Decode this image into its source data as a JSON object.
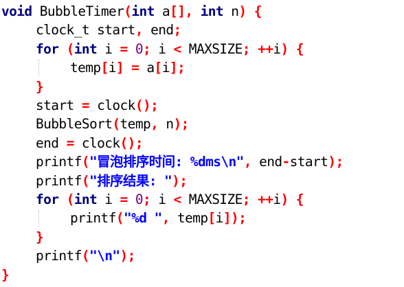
{
  "code": {
    "lines": [
      {
        "indent": 0,
        "tokens": [
          {
            "t": "kw",
            "v": "void"
          },
          {
            "t": "plain",
            "v": " BubbleTimer"
          },
          {
            "t": "op",
            "v": "("
          },
          {
            "t": "kw",
            "v": "int"
          },
          {
            "t": "plain",
            "v": " a"
          },
          {
            "t": "op",
            "v": "[],"
          },
          {
            "t": "plain",
            "v": " "
          },
          {
            "t": "kw",
            "v": "int"
          },
          {
            "t": "plain",
            "v": " n"
          },
          {
            "t": "op",
            "v": ")"
          },
          {
            "t": "plain",
            "v": " "
          },
          {
            "t": "op",
            "v": "{"
          }
        ]
      },
      {
        "indent": 1,
        "tokens": [
          {
            "t": "plain",
            "v": "clock_t start"
          },
          {
            "t": "op",
            "v": ","
          },
          {
            "t": "plain",
            "v": " end"
          },
          {
            "t": "op",
            "v": ";"
          }
        ]
      },
      {
        "indent": 1,
        "tokens": [
          {
            "t": "kw",
            "v": "for"
          },
          {
            "t": "plain",
            "v": " "
          },
          {
            "t": "op",
            "v": "("
          },
          {
            "t": "kw",
            "v": "int"
          },
          {
            "t": "plain",
            "v": " i "
          },
          {
            "t": "op",
            "v": "="
          },
          {
            "t": "plain",
            "v": " "
          },
          {
            "t": "num",
            "v": "0"
          },
          {
            "t": "op",
            "v": ";"
          },
          {
            "t": "plain",
            "v": " i "
          },
          {
            "t": "op",
            "v": "<"
          },
          {
            "t": "plain",
            "v": " MAXSIZE"
          },
          {
            "t": "op",
            "v": ";"
          },
          {
            "t": "plain",
            "v": " "
          },
          {
            "t": "op",
            "v": "++"
          },
          {
            "t": "plain",
            "v": "i"
          },
          {
            "t": "op",
            "v": ")"
          },
          {
            "t": "plain",
            "v": " "
          },
          {
            "t": "op",
            "v": "{"
          }
        ]
      },
      {
        "indent": 2,
        "tokens": [
          {
            "t": "plain",
            "v": "temp"
          },
          {
            "t": "op",
            "v": "["
          },
          {
            "t": "plain",
            "v": "i"
          },
          {
            "t": "op",
            "v": "]"
          },
          {
            "t": "plain",
            "v": " "
          },
          {
            "t": "op",
            "v": "="
          },
          {
            "t": "plain",
            "v": " a"
          },
          {
            "t": "op",
            "v": "["
          },
          {
            "t": "plain",
            "v": "i"
          },
          {
            "t": "op",
            "v": "];"
          }
        ]
      },
      {
        "indent": 1,
        "tokens": [
          {
            "t": "op",
            "v": "}"
          }
        ]
      },
      {
        "indent": 1,
        "tokens": [
          {
            "t": "plain",
            "v": "start "
          },
          {
            "t": "op",
            "v": "="
          },
          {
            "t": "plain",
            "v": " clock"
          },
          {
            "t": "op",
            "v": "();"
          }
        ]
      },
      {
        "indent": 1,
        "tokens": [
          {
            "t": "plain",
            "v": "BubbleSort"
          },
          {
            "t": "op",
            "v": "("
          },
          {
            "t": "plain",
            "v": "temp"
          },
          {
            "t": "op",
            "v": ","
          },
          {
            "t": "plain",
            "v": " n"
          },
          {
            "t": "op",
            "v": ");"
          }
        ]
      },
      {
        "indent": 1,
        "tokens": [
          {
            "t": "plain",
            "v": "end "
          },
          {
            "t": "op",
            "v": "="
          },
          {
            "t": "plain",
            "v": " clock"
          },
          {
            "t": "op",
            "v": "();"
          }
        ]
      },
      {
        "indent": 1,
        "tokens": [
          {
            "t": "plain",
            "v": "printf"
          },
          {
            "t": "op",
            "v": "("
          },
          {
            "t": "str",
            "v": "\"冒泡排序时间: %dms\\n\""
          },
          {
            "t": "op",
            "v": ","
          },
          {
            "t": "plain",
            "v": " end"
          },
          {
            "t": "op",
            "v": "-"
          },
          {
            "t": "plain",
            "v": "start"
          },
          {
            "t": "op",
            "v": ");"
          }
        ]
      },
      {
        "indent": 1,
        "tokens": [
          {
            "t": "plain",
            "v": "printf"
          },
          {
            "t": "op",
            "v": "("
          },
          {
            "t": "str",
            "v": "\"排序结果: \""
          },
          {
            "t": "op",
            "v": ");"
          }
        ]
      },
      {
        "indent": 1,
        "tokens": [
          {
            "t": "kw",
            "v": "for"
          },
          {
            "t": "plain",
            "v": " "
          },
          {
            "t": "op",
            "v": "("
          },
          {
            "t": "kw",
            "v": "int"
          },
          {
            "t": "plain",
            "v": " i "
          },
          {
            "t": "op",
            "v": "="
          },
          {
            "t": "plain",
            "v": " "
          },
          {
            "t": "num",
            "v": "0"
          },
          {
            "t": "op",
            "v": ";"
          },
          {
            "t": "plain",
            "v": " i "
          },
          {
            "t": "op",
            "v": "<"
          },
          {
            "t": "plain",
            "v": " MAXSIZE"
          },
          {
            "t": "op",
            "v": ";"
          },
          {
            "t": "plain",
            "v": " "
          },
          {
            "t": "op",
            "v": "++"
          },
          {
            "t": "plain",
            "v": "i"
          },
          {
            "t": "op",
            "v": ")"
          },
          {
            "t": "plain",
            "v": " "
          },
          {
            "t": "op",
            "v": "{"
          }
        ]
      },
      {
        "indent": 2,
        "tokens": [
          {
            "t": "plain",
            "v": "printf"
          },
          {
            "t": "op",
            "v": "("
          },
          {
            "t": "str",
            "v": "\"%d \""
          },
          {
            "t": "op",
            "v": ","
          },
          {
            "t": "plain",
            "v": " temp"
          },
          {
            "t": "op",
            "v": "["
          },
          {
            "t": "plain",
            "v": "i"
          },
          {
            "t": "op",
            "v": "]);"
          }
        ]
      },
      {
        "indent": 1,
        "tokens": [
          {
            "t": "op",
            "v": "}"
          }
        ]
      },
      {
        "indent": 1,
        "tokens": [
          {
            "t": "plain",
            "v": "printf"
          },
          {
            "t": "op",
            "v": "("
          },
          {
            "t": "str",
            "v": "\"\\n\""
          },
          {
            "t": "op",
            "v": ");"
          }
        ]
      },
      {
        "indent": 0,
        "tokens": [
          {
            "t": "op",
            "v": "}"
          }
        ]
      }
    ]
  },
  "colors": {
    "keyword": "#000080",
    "operator": "#ff0000",
    "string": "#0000ff",
    "number": "#800080",
    "text": "#000000",
    "background": "#ffffff"
  }
}
